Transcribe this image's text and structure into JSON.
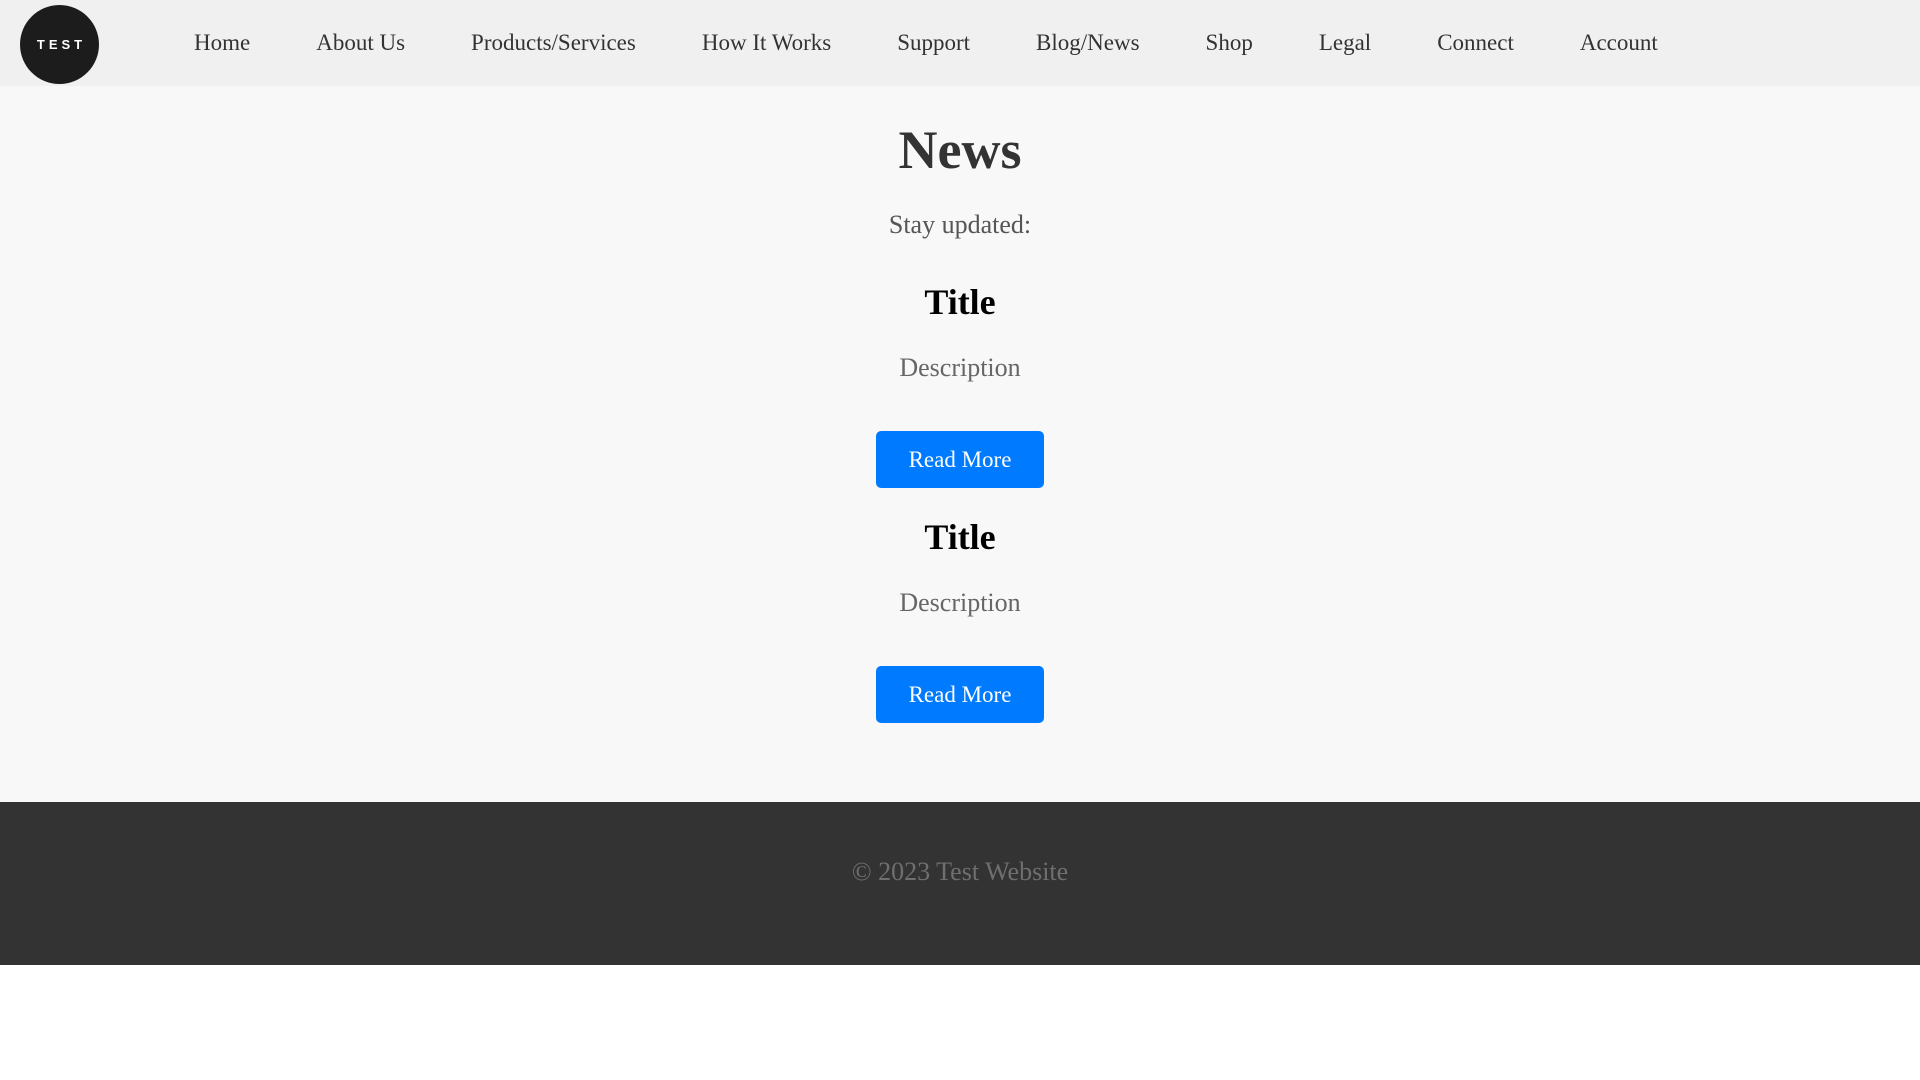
{
  "header": {
    "logo_text": "TEST",
    "nav": [
      {
        "label": "Home"
      },
      {
        "label": "About Us"
      },
      {
        "label": "Products/Services"
      },
      {
        "label": "How It Works"
      },
      {
        "label": "Support"
      },
      {
        "label": "Blog/News"
      },
      {
        "label": "Shop"
      },
      {
        "label": "Legal"
      },
      {
        "label": "Connect"
      },
      {
        "label": "Account"
      }
    ]
  },
  "main": {
    "title": "News",
    "subtitle": "Stay updated:",
    "articles": [
      {
        "title": "Title",
        "description": "Description",
        "button": "Read More"
      },
      {
        "title": "Title",
        "description": "Description",
        "button": "Read More"
      }
    ]
  },
  "footer": {
    "text": "© 2023 Test Website"
  },
  "colors": {
    "header_bg": "#f0f0f0",
    "main_bg": "#f8f8f8",
    "footer_bg": "#333333",
    "button_bg": "#007bff",
    "logo_bg": "#1c1c1c"
  }
}
